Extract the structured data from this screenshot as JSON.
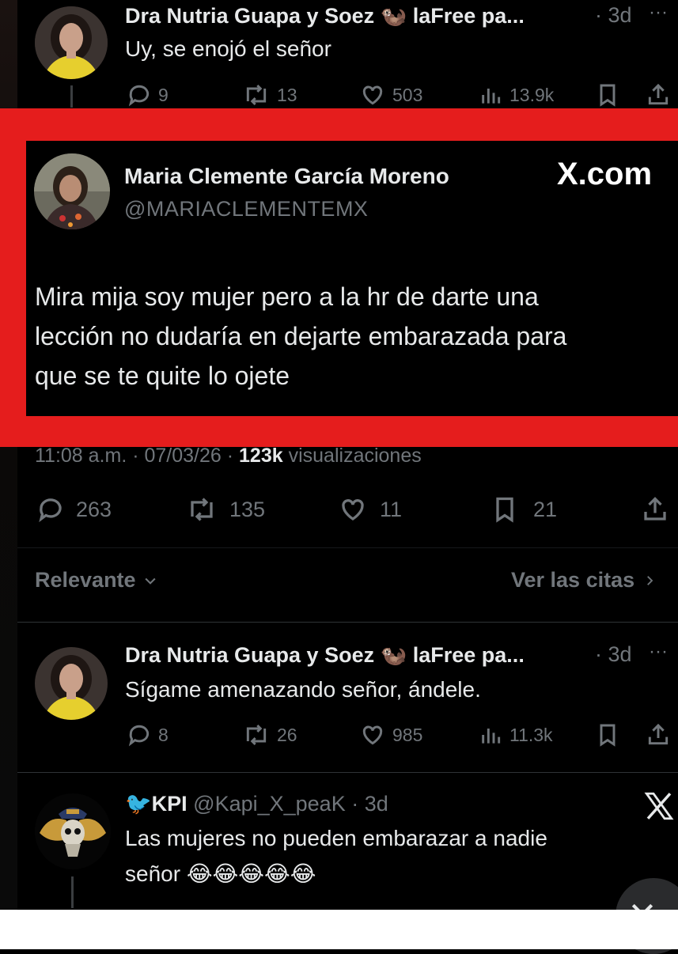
{
  "tweet1": {
    "name": "Dra Nutria Guapa y Soez",
    "emoji": "🦦",
    "name_suffix": "laFree pa...",
    "time": "· 3d",
    "more": "···",
    "text": "Uy, se enojó el señor",
    "replies": "9",
    "retweets": "13",
    "likes": "503",
    "views": "13.9k"
  },
  "quoted": {
    "name": "Maria Clemente García Moreno",
    "handle": "@MARIACLEMENTEMX",
    "brand": "X.com",
    "text_lines": [
      "Mira mija soy mujer pero a la hr de darte una",
      "lección no dudaría en dejarte embarazada para",
      "que se te quite lo ojete"
    ],
    "meta_time": "11:08 a.m. · 07/03/26 · ",
    "meta_views": "123k",
    "meta_views_label": " visualizaciones",
    "replies": "263",
    "retweets": "135",
    "likes": "11",
    "bookmarks": "21"
  },
  "sort": {
    "label": "Relevante",
    "citas": "Ver las citas"
  },
  "tweet2": {
    "name": "Dra Nutria Guapa y Soez",
    "emoji": "🦦",
    "name_suffix": "laFree pa...",
    "time": "· 3d",
    "more": "···",
    "text": "Sígame amenazando señor, ándele.",
    "replies": "8",
    "retweets": "26",
    "likes": "985",
    "views": "11.3k"
  },
  "tweet3": {
    "name_prefix": "🐦",
    "name": "KPI",
    "handle": "@Kapi_X_peaK",
    "time": "· 3d",
    "text_line1": "Las mujeres no pueden embarazar a nadie",
    "text_line2": "señor",
    "emojis": "😂😂😂😂😂"
  },
  "colors": {
    "highlight": "#e51d1d",
    "background": "#000000",
    "text": "#e7e9ea",
    "muted": "#71767b"
  }
}
